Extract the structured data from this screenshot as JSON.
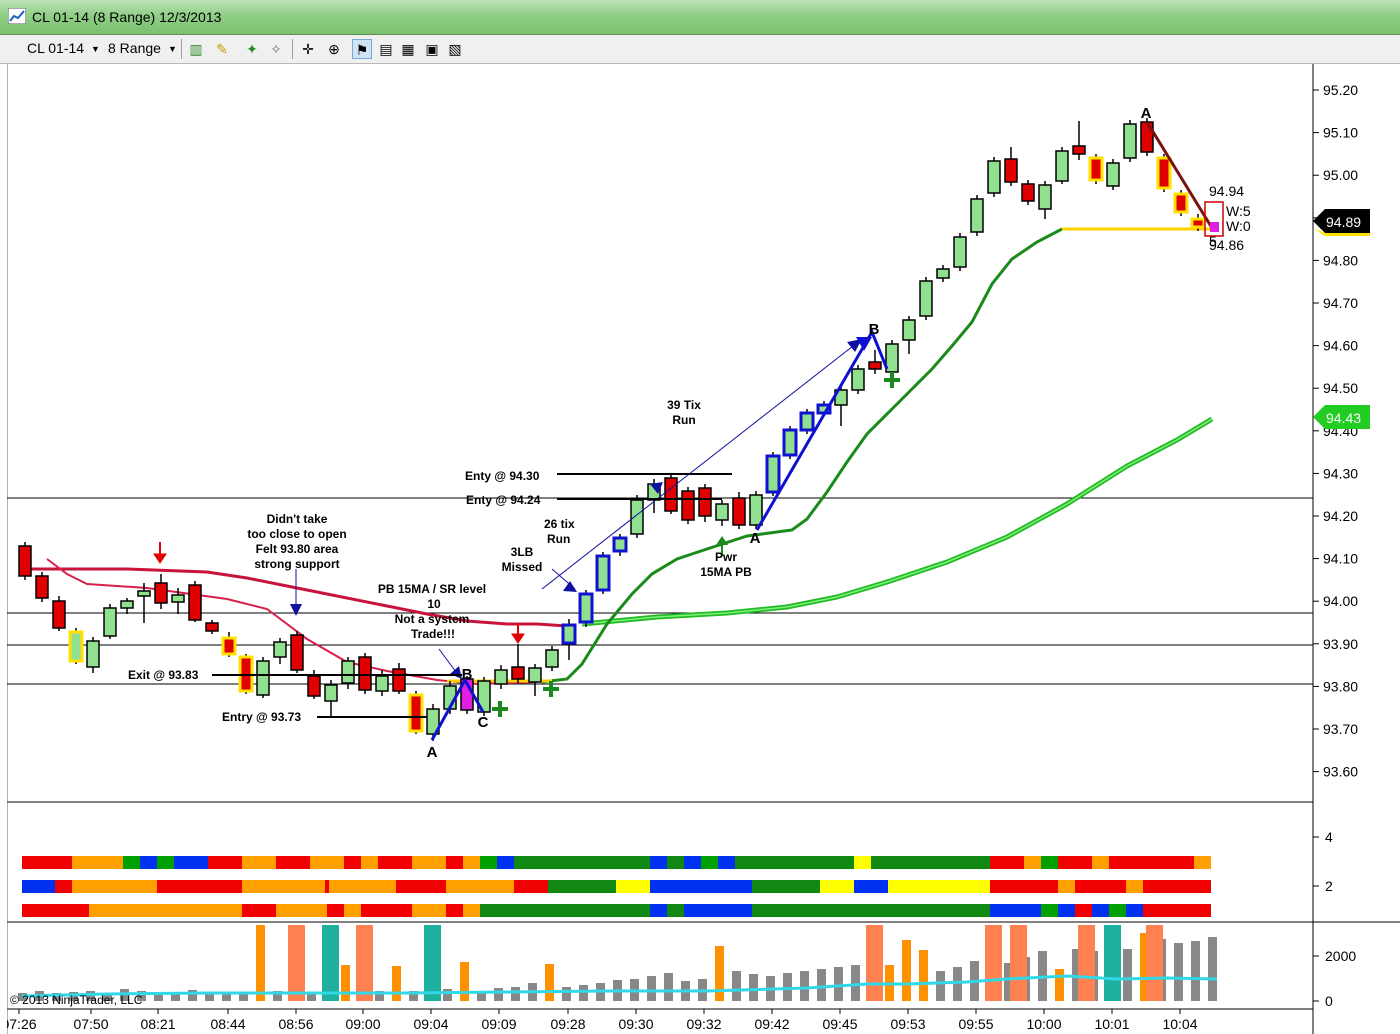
{
  "window": {
    "title": "CL 01-14 (8 Range)  12/3/2013",
    "copyright": "© 2013 NinjaTrader, LLC"
  },
  "toolbar": {
    "instrument": "CL 01-14",
    "period": "8 Range"
  },
  "price_axis": {
    "ticks": [
      "95.20",
      "95.10",
      "95.00",
      "94.90",
      "94.80",
      "94.70",
      "94.60",
      "94.50",
      "94.40",
      "94.30",
      "94.20",
      "94.10",
      "94.00",
      "93.90",
      "93.80",
      "93.70",
      "93.60"
    ],
    "last_price": "94.89",
    "ma_price": "94.43"
  },
  "ind_axis": {
    "ticks": [
      "4",
      "2"
    ]
  },
  "vol_axis": {
    "ticks": [
      "2000",
      "0"
    ]
  },
  "time_axis": {
    "ticks": [
      "07:26",
      "07:50",
      "08:21",
      "08:44",
      "08:56",
      "09:00",
      "09:04",
      "09:09",
      "09:28",
      "09:30",
      "09:32",
      "09:42",
      "09:45",
      "09:53",
      "09:55",
      "10:00",
      "10:01",
      "10:04"
    ]
  },
  "annotations": {
    "tix39": [
      "39 Tix",
      "Run"
    ],
    "entry9430": "Enty @ 94.30",
    "entry9424": "Enty @ 94.24",
    "tix26": [
      "26 tix",
      "Run"
    ],
    "lb3": [
      "3LB",
      "Missed"
    ],
    "didnt": [
      "Didn't take",
      "too close to open",
      "Felt 93.80 area",
      "strong support"
    ],
    "pb": [
      "PB 15MA / SR level",
      "10",
      "Not a system",
      "Trade!!!"
    ],
    "exit": "Exit @ 93.83",
    "entry9373": "Entry @ 93.73",
    "pwr": [
      "Pwr",
      "15MA PB"
    ],
    "a1": "A",
    "b1": "B",
    "c1": "C",
    "a2": "A",
    "b2": "B",
    "a3": "A",
    "p9494": "94.94",
    "w5": "W:5",
    "w0": "W:0",
    "p9486": "94.86",
    "five": "5"
  },
  "colors": {
    "up": "#90e090",
    "down": "#e00000",
    "ma15": "#1a8a1a",
    "ma_slow": "#33cc33",
    "ma_red": "#c8143c",
    "blue": "#1010d0",
    "yellow": "#ffe000"
  }
}
